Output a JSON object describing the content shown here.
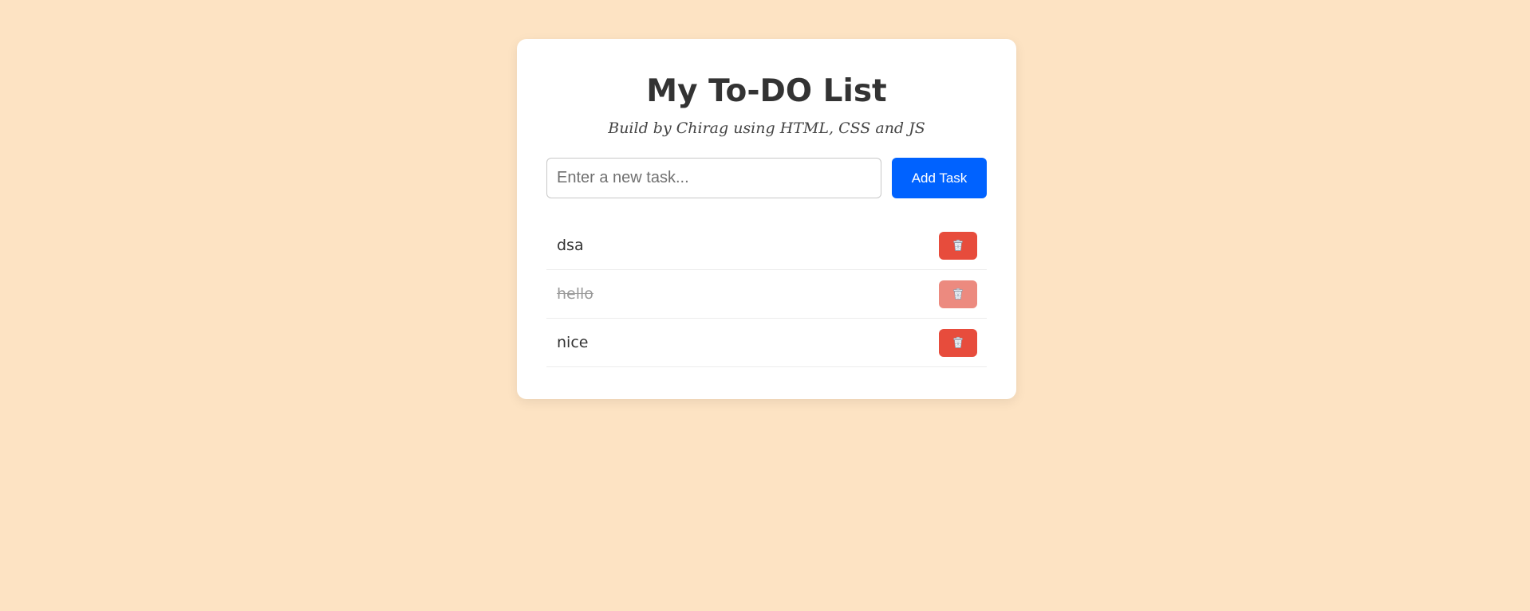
{
  "app": {
    "title": "My To-DO List",
    "subtitle": "Build by Chirag using HTML, CSS and JS"
  },
  "input": {
    "placeholder": "Enter a new task...",
    "value": ""
  },
  "add_button": {
    "label": "Add Task"
  },
  "tasks": [
    {
      "text": "dsa",
      "completed": false,
      "delete_icon": "trash-icon"
    },
    {
      "text": "hello",
      "completed": true,
      "delete_icon": "trash-icon"
    },
    {
      "text": "nice",
      "completed": false,
      "delete_icon": "trash-icon"
    }
  ],
  "colors": {
    "background": "#fde3c3",
    "card": "#ffffff",
    "accent": "#0062ff",
    "delete": "#e74c3c",
    "delete_completed": "#ec8a7f"
  }
}
